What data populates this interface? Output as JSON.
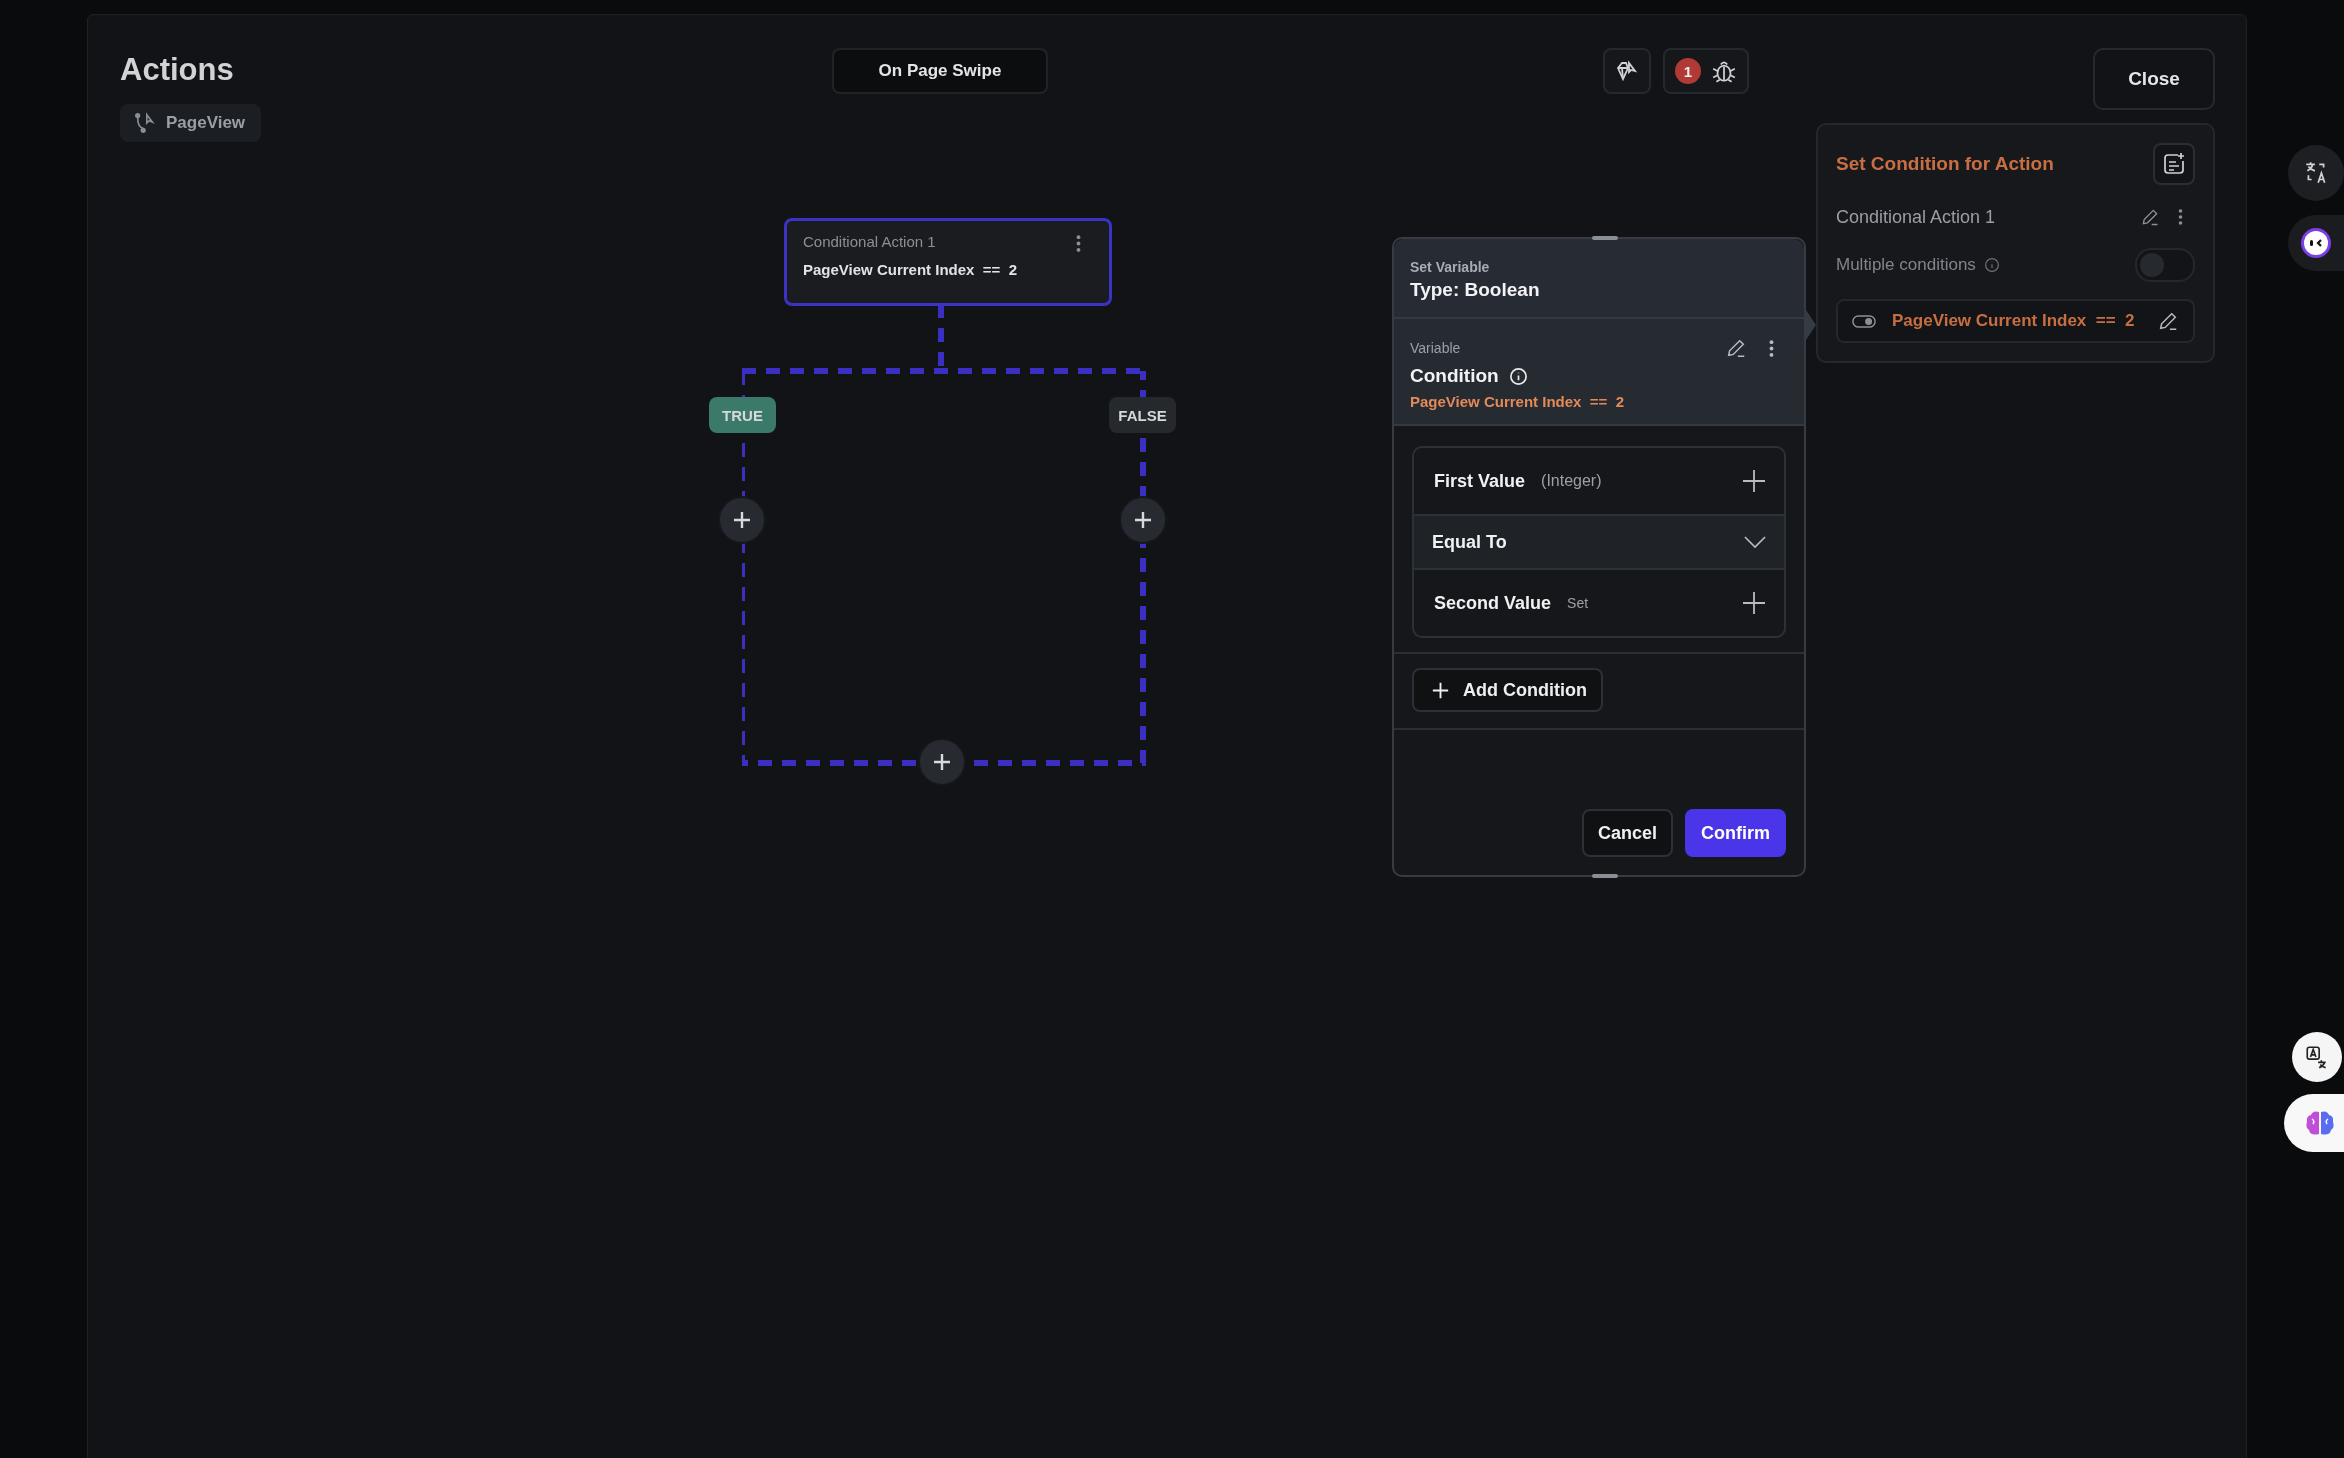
{
  "header": {
    "title": "Actions",
    "widget": "PageView",
    "trigger": "On Page Swipe",
    "error_count": "1",
    "close": "Close"
  },
  "flow": {
    "node": {
      "title": "Conditional Action 1",
      "condition": "PageView Current Index  ==  2",
      "selected": true
    },
    "branches": [
      {
        "label": "TRUE",
        "kind": "true"
      },
      {
        "label": "FALSE",
        "kind": "false"
      }
    ]
  },
  "condition_editor": {
    "eyebrow": "Set Variable",
    "type": "Type: Boolean",
    "variable_label": "Variable",
    "variable_name": "Condition",
    "expression": "PageView Current Index  ==  2",
    "first_value": {
      "label": "First Value",
      "hint": "(Integer)"
    },
    "operator": "Equal To",
    "second_value": {
      "label": "Second Value",
      "hint": "Set"
    },
    "add_button": "Add Condition",
    "cancel": "Cancel",
    "confirm": "Confirm"
  },
  "condition_panel": {
    "title": "Set Condition for Action",
    "action_name": "Conditional Action 1",
    "multiple_conditions": {
      "label": "Multiple conditions",
      "on": false
    },
    "condition": "PageView Current Index  ==  2"
  }
}
